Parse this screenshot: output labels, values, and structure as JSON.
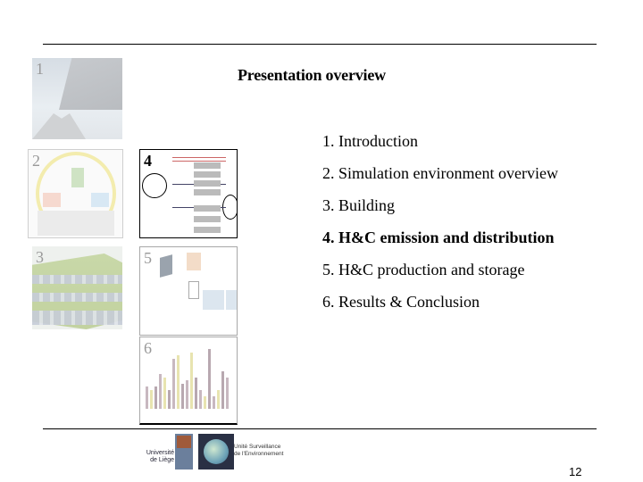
{
  "slide": {
    "title": "Presentation overview",
    "page_number": "12",
    "agenda": [
      {
        "label": "1. Introduction",
        "active": false
      },
      {
        "label": "2. Simulation environment overview",
        "active": false
      },
      {
        "label": "3. Building",
        "active": false
      },
      {
        "label": "4. H&C emission and distribution",
        "active": true
      },
      {
        "label": "5. H&C production and storage",
        "active": false
      },
      {
        "label": "6. Results & Conclusion",
        "active": false
      }
    ],
    "thumbnails": [
      {
        "number": "1",
        "icon": "roof-photo-icon",
        "highlighted": false
      },
      {
        "number": "2",
        "icon": "simulation-cycle-diagram-icon",
        "highlighted": false
      },
      {
        "number": "3",
        "icon": "building-model-icon",
        "highlighted": false
      },
      {
        "number": "4",
        "icon": "emission-distribution-diagram-icon",
        "highlighted": true
      },
      {
        "number": "5",
        "icon": "production-storage-diagram-icon",
        "highlighted": false
      },
      {
        "number": "6",
        "icon": "results-bar-chart-icon",
        "highlighted": false
      }
    ],
    "logos": {
      "ulg_text": "Université de Liège",
      "ulg_mark": "ULg",
      "surveillance_text": "Unité Surveillance de l'Environnement"
    },
    "thumb6_bars": [
      0.35,
      0.3,
      0.35,
      0.55,
      0.5,
      0.3,
      0.8,
      0.85,
      0.4,
      0.45,
      0.9,
      0.5,
      0.3,
      0.2,
      0.95,
      0.2,
      0.3,
      0.6,
      0.5
    ]
  }
}
